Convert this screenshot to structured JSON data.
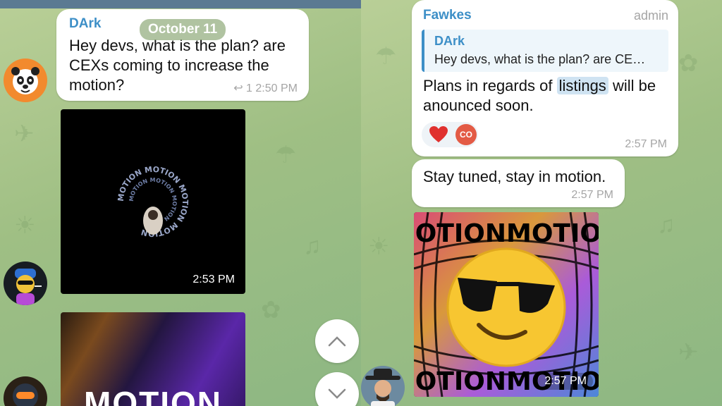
{
  "left": {
    "date_pill": "October 11",
    "message1": {
      "sender": "DArk",
      "text": "Hey devs, what is the plan? are CEXs coming to increase the motion?",
      "reply_count": "1",
      "time": "2:50 PM"
    },
    "video1": {
      "time": "2:53 PM",
      "ring_text": "MOTION MOTION MOTION MOTION"
    },
    "image2": {
      "text": "MOTION"
    },
    "scroll_up_icon": "chevron-up-icon",
    "scroll_down_icon": "chevron-down-icon"
  },
  "right": {
    "message1": {
      "sender": "Fawkes",
      "role": "admin",
      "quote_sender": "DArk",
      "quote_text": "Hey devs, what is the plan? are CE…",
      "text_before": "Plans in regards of",
      "text_highlight": "listings",
      "text_after": "will be anounced soon.",
      "reaction_avatar": "CO",
      "time": "2:57 PM"
    },
    "message2": {
      "text": "Stay tuned, stay in motion.",
      "time": "2:57 PM"
    },
    "sticker": {
      "time": "2:57 PM",
      "text": "MOTIONMOTION"
    }
  },
  "colors": {
    "accent": "#3d8fc7",
    "reaction_red": "#e0312f"
  }
}
